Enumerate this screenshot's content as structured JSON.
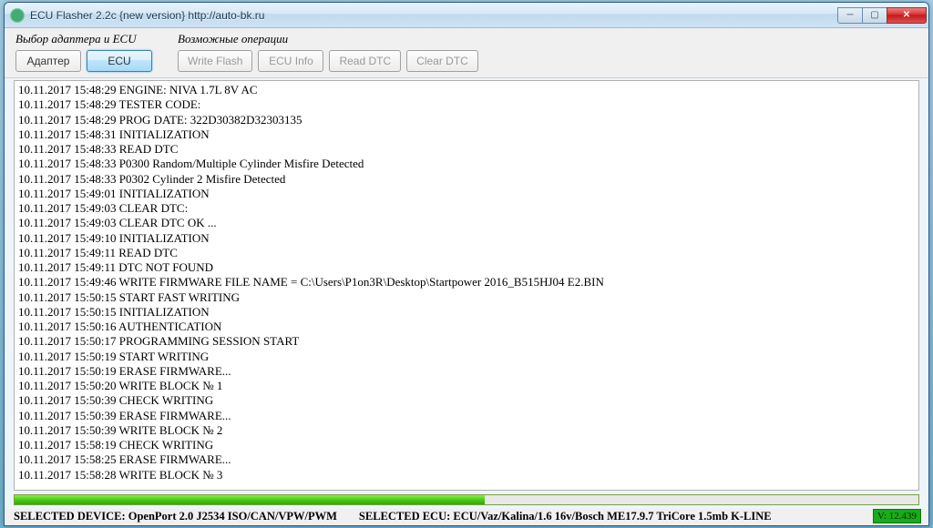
{
  "title": "ECU Flasher 2.2c {new version} http://auto-bk.ru",
  "groups": {
    "adapter": {
      "label": "Выбор адаптера и ECU",
      "buttons": {
        "adapter": "Адаптер",
        "ecu": "ECU"
      }
    },
    "ops": {
      "label": "Возможные операции",
      "buttons": {
        "write_flash": "Write Flash",
        "ecu_info": "ECU Info",
        "read_dtc": "Read DTC",
        "clear_dtc": "Clear DTC"
      }
    }
  },
  "log": [
    "10.11.2017 15:48:29 ENGINE: NIVA 1.7L 8V AC",
    "10.11.2017 15:48:29 TESTER CODE:",
    "10.11.2017 15:48:29 PROG DATE: 322D30382D32303135",
    "10.11.2017 15:48:31 INITIALIZATION",
    "10.11.2017 15:48:33 READ DTC",
    "10.11.2017 15:48:33 P0300 Random/Multiple Cylinder Misfire Detected",
    "10.11.2017 15:48:33 P0302 Cylinder 2 Misfire Detected",
    "10.11.2017 15:49:01 INITIALIZATION",
    "10.11.2017 15:49:03 CLEAR DTC:",
    "10.11.2017 15:49:03 CLEAR DTC OK ...",
    "10.11.2017 15:49:10 INITIALIZATION",
    "10.11.2017 15:49:11 READ DTC",
    "10.11.2017 15:49:11 DTC NOT FOUND",
    "10.11.2017 15:49:46 WRITE FIRMWARE FILE NAME = C:\\Users\\P1on3R\\Desktop\\Startpower 2016_B515HJ04 E2.BIN",
    "10.11.2017 15:50:15 START FAST WRITING",
    "10.11.2017 15:50:15 INITIALIZATION",
    "10.11.2017 15:50:16 AUTHENTICATION",
    "10.11.2017 15:50:17 PROGRAMMING SESSION START",
    "10.11.2017 15:50:19 START WRITING",
    "10.11.2017 15:50:19 ERASE FIRMWARE...",
    "10.11.2017 15:50:20 WRITE BLOCK № 1",
    "10.11.2017 15:50:39 CHECK WRITING",
    "10.11.2017 15:50:39 ERASE FIRMWARE...",
    "10.11.2017 15:50:39 WRITE BLOCK № 2",
    "10.11.2017 15:58:19 CHECK WRITING",
    "10.11.2017 15:58:25 ERASE FIRMWARE...",
    "10.11.2017 15:58:28 WRITE BLOCK № 3"
  ],
  "progress_percent": 52,
  "status": {
    "device_label": "SELECTED DEVICE: ",
    "device_value": "OpenPort 2.0 J2534 ISO/CAN/VPW/PWM",
    "ecu_label": "SELECTED ECU: ",
    "ecu_value": "ECU/Vaz/Kalina/1.6 16v/Bosch ME17.9.7 TriCore 1.5mb K-LINE",
    "version": "V: 12.439"
  }
}
